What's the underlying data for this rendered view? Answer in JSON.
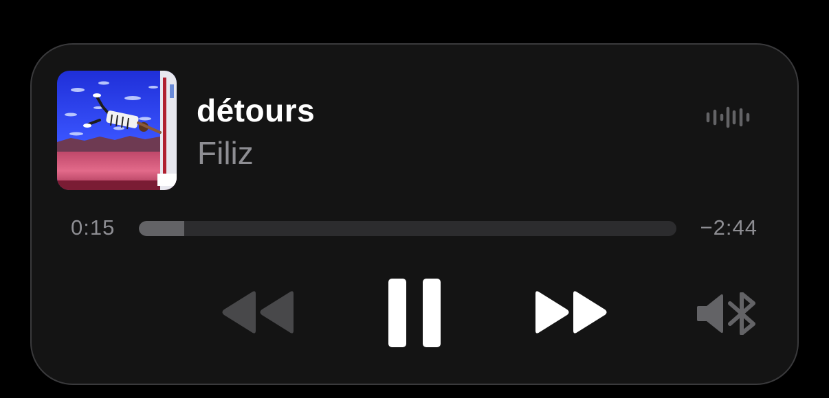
{
  "track": {
    "title": "détours",
    "artist": "Filiz"
  },
  "playback": {
    "elapsed": "0:15",
    "remaining": "−2:44",
    "progress_fraction": 0.084,
    "state": "playing"
  },
  "icons": {
    "now_playing": "waveform-icon",
    "rewind": "backward-icon",
    "pause": "pause-icon",
    "forward": "forward-icon",
    "audio_output": "speaker-bluetooth-icon"
  },
  "colors": {
    "background": "#000000",
    "card": "#141414",
    "title": "#ffffff",
    "secondary": "#8e8e93",
    "track": "#2c2c2e",
    "fill": "#636366",
    "disabled_control": "#48484a"
  }
}
